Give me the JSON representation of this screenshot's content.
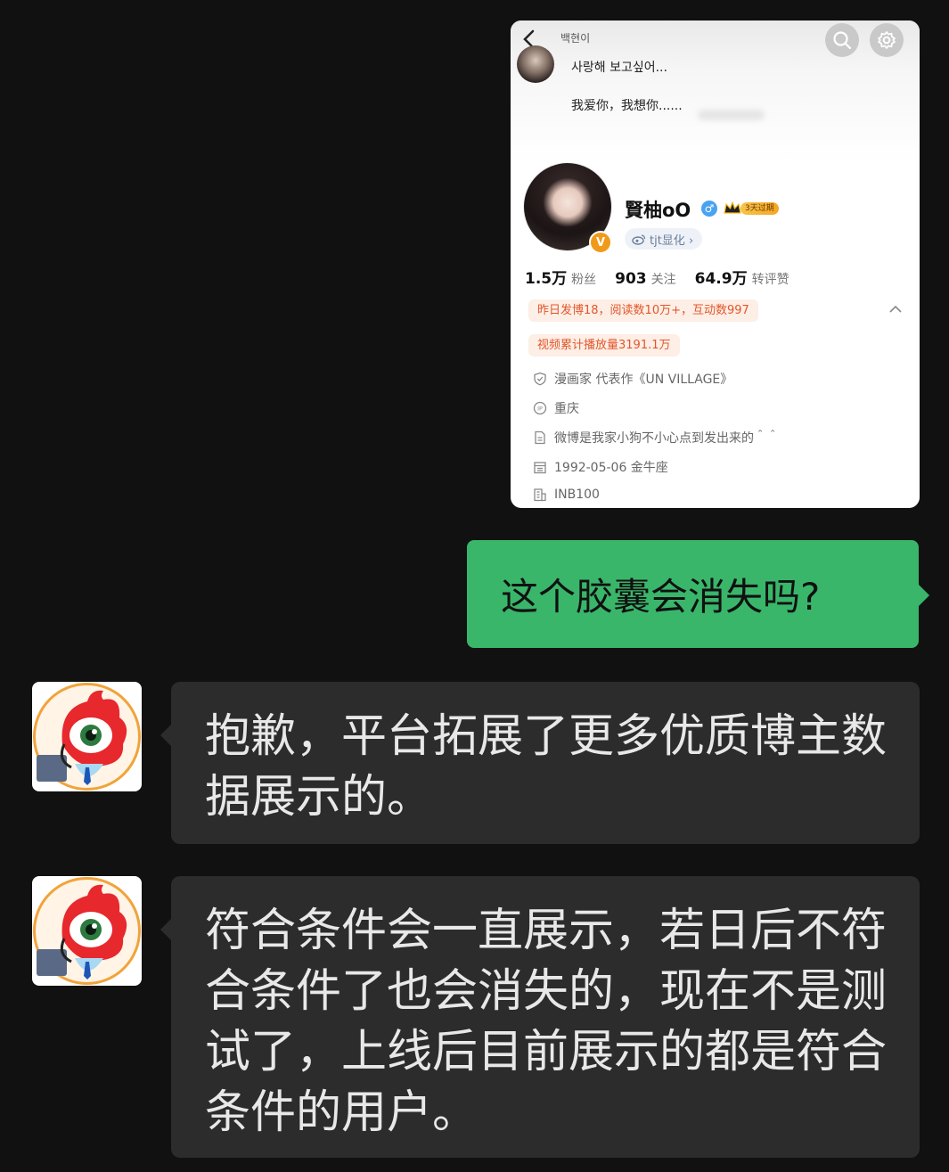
{
  "screenshot": {
    "story": {
      "name": "백현이",
      "line1": "사랑해 보고싶어...",
      "line2": "我爱你，我想你......"
    },
    "profile": {
      "name": "賢柚oO",
      "v_badge": "V",
      "vip_label": "3天过期",
      "link_text": "tjt显化 ›",
      "stats": [
        {
          "value": "1.5万",
          "label": "粉丝"
        },
        {
          "value": "903",
          "label": "关注"
        },
        {
          "value": "64.9万",
          "label": "转评赞"
        }
      ],
      "pill_1": "昨日发博18，阅读数10万+，互动数997",
      "pill_2": "视频累计播放量3191.1万",
      "info": [
        {
          "icon": "shield-check-icon",
          "text": "漫画家 代表作《UN VILLAGE》"
        },
        {
          "icon": "ip-location-icon",
          "text": "重庆"
        },
        {
          "icon": "document-icon",
          "text": "微博是我家小狗不小心点到发出来的＾＾"
        },
        {
          "icon": "calendar-icon",
          "text": "1992-05-06 金牛座"
        },
        {
          "icon": "building-icon",
          "text": "INB100"
        }
      ]
    }
  },
  "messages": {
    "outgoing": "这个胶囊会消失吗?",
    "reply_1": "抱歉，平台拓展了更多优质博主数据展示的。",
    "reply_2": "符合条件会一直展示，若日后不符合条件了也会消失的，现在不是测试了，上线后目前展示的都是符合条件的用户。"
  },
  "colors": {
    "background": "#111111",
    "outgoing_bubble": "#39b66a",
    "incoming_bubble": "#2c2c2c",
    "weibo_red": "#e6282d",
    "weibo_orange": "#f39a1e"
  }
}
